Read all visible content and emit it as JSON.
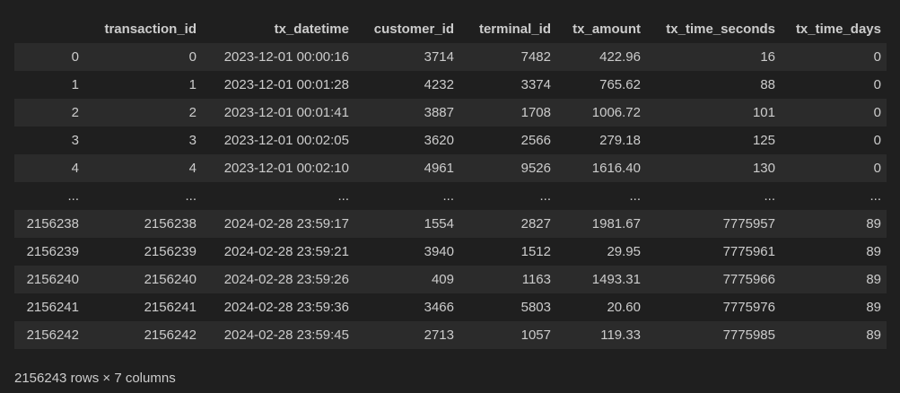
{
  "table": {
    "columns": [
      "",
      "transaction_id",
      "tx_datetime",
      "customer_id",
      "terminal_id",
      "tx_amount",
      "tx_time_seconds",
      "tx_time_days"
    ],
    "rows": [
      [
        "0",
        "0",
        "2023-12-01 00:00:16",
        "3714",
        "7482",
        "422.96",
        "16",
        "0"
      ],
      [
        "1",
        "1",
        "2023-12-01 00:01:28",
        "4232",
        "3374",
        "765.62",
        "88",
        "0"
      ],
      [
        "2",
        "2",
        "2023-12-01 00:01:41",
        "3887",
        "1708",
        "1006.72",
        "101",
        "0"
      ],
      [
        "3",
        "3",
        "2023-12-01 00:02:05",
        "3620",
        "2566",
        "279.18",
        "125",
        "0"
      ],
      [
        "4",
        "4",
        "2023-12-01 00:02:10",
        "4961",
        "9526",
        "1616.40",
        "130",
        "0"
      ],
      [
        "...",
        "...",
        "...",
        "...",
        "...",
        "...",
        "...",
        "..."
      ],
      [
        "2156238",
        "2156238",
        "2024-02-28 23:59:17",
        "1554",
        "2827",
        "1981.67",
        "7775957",
        "89"
      ],
      [
        "2156239",
        "2156239",
        "2024-02-28 23:59:21",
        "3940",
        "1512",
        "29.95",
        "7775961",
        "89"
      ],
      [
        "2156240",
        "2156240",
        "2024-02-28 23:59:26",
        "409",
        "1163",
        "1493.31",
        "7775966",
        "89"
      ],
      [
        "2156241",
        "2156241",
        "2024-02-28 23:59:36",
        "3466",
        "5803",
        "20.60",
        "7775976",
        "89"
      ],
      [
        "2156242",
        "2156242",
        "2024-02-28 23:59:45",
        "2713",
        "1057",
        "119.33",
        "7775985",
        "89"
      ]
    ]
  },
  "footer": {
    "shape_text": "2156243 rows × 7 columns"
  }
}
